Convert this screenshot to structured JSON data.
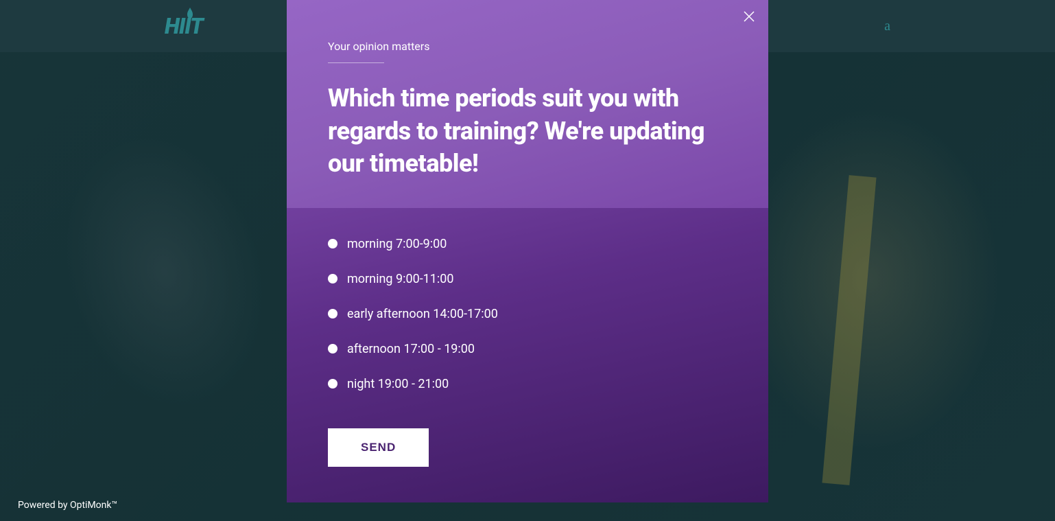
{
  "header": {
    "logo_text": "HIIT",
    "right_letter": "a"
  },
  "modal": {
    "subtitle": "Your opinion matters",
    "title": "Which time periods suit you with regards to training? We're updating our timetable!",
    "options": [
      {
        "label": "morning 7:00-9:00"
      },
      {
        "label": "morning 9:00-11:00"
      },
      {
        "label": "early afternoon 14:00-17:00"
      },
      {
        "label": "afternoon 17:00 - 19:00"
      },
      {
        "label": "night 19:00 - 21:00"
      }
    ],
    "send_button": "SEND"
  },
  "footer": {
    "powered_by": "Powered by OptiMonk™"
  }
}
